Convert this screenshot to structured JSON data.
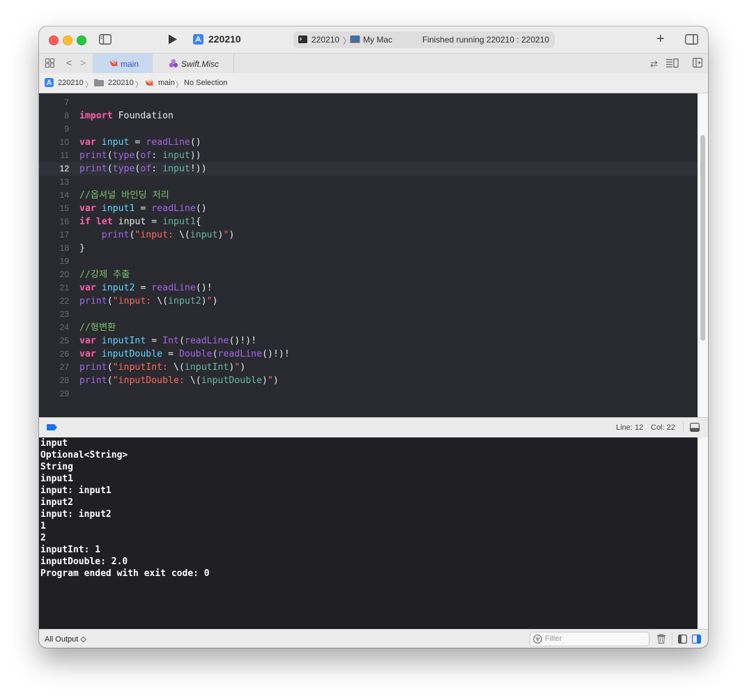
{
  "toolbar": {
    "scheme": "220210",
    "destination_project": "220210",
    "destination_device": "My Mac",
    "status": "Finished running 220210 : 220210"
  },
  "tabs": [
    {
      "label": "main",
      "active": true,
      "icon": "swift-icon"
    },
    {
      "label": "Swift.Misc",
      "active": false,
      "icon": "framework-icon"
    }
  ],
  "jumpbar": {
    "items": [
      "220210",
      "220210",
      "main",
      "No Selection"
    ]
  },
  "editor": {
    "current_line": 12,
    "lines": [
      {
        "n": "7",
        "code": ""
      },
      {
        "n": "8",
        "code": "import Foundation"
      },
      {
        "n": "9",
        "code": ""
      },
      {
        "n": "10",
        "code": "var input = readLine()"
      },
      {
        "n": "11",
        "code": "print(type(of: input))"
      },
      {
        "n": "12",
        "code": "print(type(of: input!))"
      },
      {
        "n": "13",
        "code": ""
      },
      {
        "n": "14",
        "code": "//옵셔널 바인딩 처리"
      },
      {
        "n": "15",
        "code": "var input1 = readLine()"
      },
      {
        "n": "16",
        "code": "if let input = input1{"
      },
      {
        "n": "17",
        "code": "    print(\"input: \\(input)\")"
      },
      {
        "n": "18",
        "code": "}"
      },
      {
        "n": "19",
        "code": ""
      },
      {
        "n": "20",
        "code": "//강제 추출"
      },
      {
        "n": "21",
        "code": "var input2 = readLine()!"
      },
      {
        "n": "22",
        "code": "print(\"input: \\(input2)\")"
      },
      {
        "n": "23",
        "code": ""
      },
      {
        "n": "24",
        "code": "//형변환"
      },
      {
        "n": "25",
        "code": "var inputInt = Int(readLine()!)!"
      },
      {
        "n": "26",
        "code": "var inputDouble = Double(readLine()!)!"
      },
      {
        "n": "27",
        "code": "print(\"inputInt: \\(inputInt)\")"
      },
      {
        "n": "28",
        "code": "print(\"inputDouble: \\(inputDouble)\")"
      },
      {
        "n": "29",
        "code": ""
      }
    ]
  },
  "debugbar": {
    "line_label": "Line: 12",
    "col_label": "Col: 22"
  },
  "console": {
    "lines": [
      "input",
      "Optional<String>",
      "String",
      "input1",
      "input: input1",
      "input2",
      "input: input2",
      "1",
      "2",
      "inputInt: 1",
      "inputDouble: 2.0",
      "Program ended with exit code: 0"
    ]
  },
  "bottombar": {
    "output_selector": "All Output ◇",
    "filter_placeholder": "Filter"
  },
  "colors": {
    "keyword": "#fc5fa3",
    "declaration": "#5dd8ff",
    "function": "#a167e6",
    "string": "#fc6a5d",
    "comment": "#7bbf6a"
  }
}
